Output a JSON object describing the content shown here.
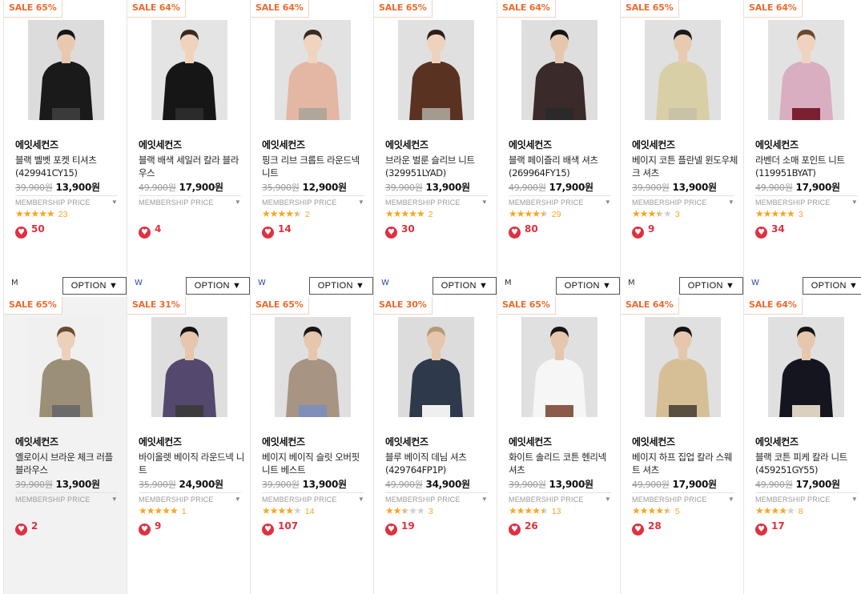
{
  "labels": {
    "membership": "MEMBERSHIP PRICE",
    "option": "OPTION ▼",
    "membership_arrow": "▼",
    "heart_glyph": "♥"
  },
  "colors": {
    "sale": "#ee6b2d",
    "star": "#f5a623",
    "heart": "#e03040"
  },
  "products": [
    {
      "sale": "SALE 65%",
      "brand": "에잇세컨즈",
      "name": "블랙 벨벳 포켓 티셔츠 (429941CY15)",
      "orig": "39,900원",
      "price": "13,900원",
      "stars": 5,
      "reviews": "23",
      "likes": "50",
      "size": "M",
      "option": true,
      "img": {
        "bg": "#dcdcdc",
        "top": "#1a1a1a",
        "bottom": "#3a3a3a",
        "skin": "#e8c9b0",
        "hair": "#151515"
      }
    },
    {
      "sale": "SALE 64%",
      "brand": "에잇세컨즈",
      "name": "블랙 배색 세일러 칼라 블라우스",
      "orig": "49,900원",
      "price": "17,900원",
      "stars": 0,
      "reviews": "",
      "likes": "4",
      "size": "W",
      "option": true,
      "img": {
        "bg": "#e4e4e4",
        "top": "#161616",
        "bottom": "#2b2b2b",
        "skin": "#efd3bd",
        "hair": "#3a2a20"
      }
    },
    {
      "sale": "SALE 64%",
      "brand": "에잇세컨즈",
      "name": "핑크 리브 크롭트 라운드넥 니트",
      "orig": "35,900원",
      "price": "12,900원",
      "stars": 4.5,
      "reviews": "2",
      "likes": "14",
      "size": "W",
      "option": true,
      "img": {
        "bg": "#e2e2e2",
        "top": "#e4b6a4",
        "bottom": "#b0a79a",
        "skin": "#f0d4bf",
        "hair": "#3b2a1f"
      }
    },
    {
      "sale": "SALE 65%",
      "brand": "에잇세컨즈",
      "name": "브라운 벌룬 슬리브 니트 (329951LYAD)",
      "orig": "39,900원",
      "price": "13,900원",
      "stars": 5,
      "reviews": "2",
      "likes": "30",
      "size": "W",
      "option": true,
      "img": {
        "bg": "#e0e0e0",
        "top": "#5a3222",
        "bottom": "#a49b8e",
        "skin": "#efd2bc",
        "hair": "#2d1e16"
      }
    },
    {
      "sale": "SALE 64%",
      "brand": "에잇세컨즈",
      "name": "블랙 페이즐리 배색 셔츠 (269964FY15)",
      "orig": "49,900원",
      "price": "17,900원",
      "stars": 4.5,
      "reviews": "29",
      "likes": "80",
      "size": "M",
      "option": true,
      "img": {
        "bg": "#dedede",
        "top": "#3a2a2a",
        "bottom": "#2a2a2a",
        "skin": "#e6c7ae",
        "hair": "#141414"
      }
    },
    {
      "sale": "SALE 65%",
      "brand": "에잇세컨즈",
      "name": "베이지 코튼 플란넬 윈도우체크 셔츠",
      "orig": "39,900원",
      "price": "13,900원",
      "stars": 3.5,
      "reviews": "3",
      "likes": "9",
      "size": "M",
      "option": true,
      "img": {
        "bg": "#e0e0e0",
        "top": "#d8cfa6",
        "bottom": "#c9c2a8",
        "skin": "#e8caaf",
        "hair": "#1a1a1a"
      }
    },
    {
      "sale": "SALE 64%",
      "brand": "에잇세컨즈",
      "name": "라벤더 소매 포인트 니트 (119951BYAT)",
      "orig": "49,900원",
      "price": "17,900원",
      "stars": 5,
      "reviews": "3",
      "likes": "34",
      "size": "W",
      "option": true,
      "img": {
        "bg": "#e2e2e2",
        "top": "#d9aec0",
        "bottom": "#7a2030",
        "skin": "#f0d3be",
        "hair": "#6a4a30"
      }
    },
    {
      "sale": "SALE 65%",
      "brand": "에잇세컨즈",
      "name": "옐로이시 브라운 체크 러플 블라우스",
      "orig": "39,900원",
      "price": "13,900원",
      "stars": 0,
      "reviews": "",
      "likes": "2",
      "size": "",
      "option": false,
      "hl": true,
      "img": {
        "bg": "#f0f0f0",
        "top": "#9c8f78",
        "bottom": "#6b6b6b",
        "skin": "#ecd0ba",
        "hair": "#6a4a2f"
      }
    },
    {
      "sale": "SALE 31%",
      "brand": "에잇세컨즈",
      "name": "바이올렛 베이직 라운드넥 니트",
      "orig": "35,900원",
      "price": "24,900원",
      "stars": 5,
      "reviews": "1",
      "likes": "9",
      "size": "",
      "option": false,
      "img": {
        "bg": "#dedede",
        "top": "#54486e",
        "bottom": "#3c3c3c",
        "skin": "#e6c7ad",
        "hair": "#141414"
      }
    },
    {
      "sale": "SALE 65%",
      "brand": "에잇세컨즈",
      "name": "베이지 베이직 슬릿 오버핏 니트 베스트",
      "orig": "39,900원",
      "price": "13,900원",
      "stars": 4,
      "reviews": "14",
      "likes": "107",
      "size": "",
      "option": false,
      "img": {
        "bg": "#e0e0e0",
        "top": "#a89482",
        "bottom": "#7f8fb8",
        "skin": "#e6c6ac",
        "hair": "#161616"
      }
    },
    {
      "sale": "SALE 30%",
      "brand": "에잇세컨즈",
      "name": "블루 베이직 데님 셔츠 (429764FP1P)",
      "orig": "49,900원",
      "price": "34,900원",
      "stars": 2.5,
      "reviews": "3",
      "likes": "19",
      "size": "",
      "option": false,
      "img": {
        "bg": "#dcdcdc",
        "top": "#2e3a4c",
        "bottom": "#efefef",
        "skin": "#e6c6ac",
        "hair": "#b59a76"
      }
    },
    {
      "sale": "SALE 65%",
      "brand": "에잇세컨즈",
      "name": "화이트 솔리드 코튼 헨리넥 셔츠",
      "orig": "39,900원",
      "price": "13,900원",
      "stars": 4.5,
      "reviews": "13",
      "likes": "26",
      "size": "",
      "option": false,
      "img": {
        "bg": "#e0e0e0",
        "top": "#f6f6f6",
        "bottom": "#8a5a4a",
        "skin": "#e6c7ae",
        "hair": "#151515"
      }
    },
    {
      "sale": "SALE 64%",
      "brand": "에잇세컨즈",
      "name": "베이지 하프 집업 칼라 스웨트 셔츠",
      "orig": "49,900원",
      "price": "17,900원",
      "stars": 4.5,
      "reviews": "5",
      "likes": "28",
      "size": "",
      "option": false,
      "img": {
        "bg": "#e0e0e0",
        "top": "#d6bf96",
        "bottom": "#5a5040",
        "skin": "#e6c7ae",
        "hair": "#141414"
      }
    },
    {
      "sale": "SALE 64%",
      "brand": "에잇세컨즈",
      "name": "블랙 코튼 피케 칼라 니트 (459251GY55)",
      "orig": "49,900원",
      "price": "17,900원",
      "stars": 4,
      "reviews": "8",
      "likes": "17",
      "size": "",
      "option": false,
      "img": {
        "bg": "#e0e0e0",
        "top": "#151520",
        "bottom": "#d9d0bf",
        "skin": "#e6c7ae",
        "hair": "#151515"
      }
    }
  ]
}
